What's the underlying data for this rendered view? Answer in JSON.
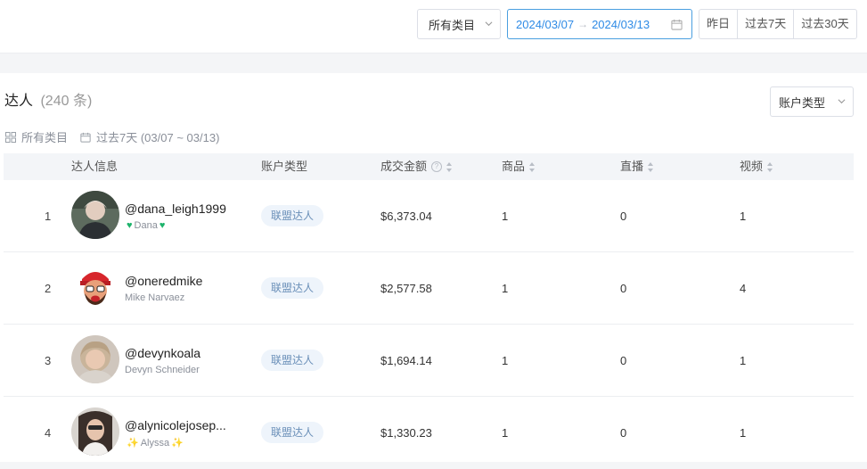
{
  "toolbar": {
    "category_select": "所有类目",
    "date_start": "2024/03/07",
    "date_end": "2024/03/13",
    "quick_ranges": [
      "昨日",
      "过去7天",
      "过去30天"
    ]
  },
  "panel": {
    "title": "达人",
    "count": "(240 条)",
    "account_type_select": "账户类型",
    "filter_category": "所有类目",
    "filter_range": "过去7天 (03/07 ~ 03/13)"
  },
  "table": {
    "headers": {
      "info": "达人信息",
      "account_type": "账户类型",
      "amount": "成交金额",
      "goods": "商品",
      "live": "直播",
      "video": "视频"
    },
    "rows": [
      {
        "rank": "1",
        "handle": "@dana_leigh1999",
        "nick": "Dana",
        "nick_decor": "💚",
        "type": "联盟达人",
        "amount": "$6,373.04",
        "goods": "1",
        "live": "0",
        "video": "1"
      },
      {
        "rank": "2",
        "handle": "@oneredmike",
        "nick": "Mike Narvaez",
        "nick_decor": "",
        "type": "联盟达人",
        "amount": "$2,577.58",
        "goods": "1",
        "live": "0",
        "video": "4"
      },
      {
        "rank": "3",
        "handle": "@devynkoala",
        "nick": "Devyn Schneider",
        "nick_decor": "",
        "type": "联盟达人",
        "amount": "$1,694.14",
        "goods": "1",
        "live": "0",
        "video": "1"
      },
      {
        "rank": "4",
        "handle": "@alynicolejosep...",
        "nick": "Alyssa",
        "nick_decor": "✨",
        "type": "联盟达人",
        "amount": "$1,330.23",
        "goods": "1",
        "live": "0",
        "video": "1"
      }
    ]
  },
  "colors": {
    "accent": "#2f8be6",
    "tag_bg": "#eef4fb",
    "tag_text": "#6a8fb8"
  }
}
